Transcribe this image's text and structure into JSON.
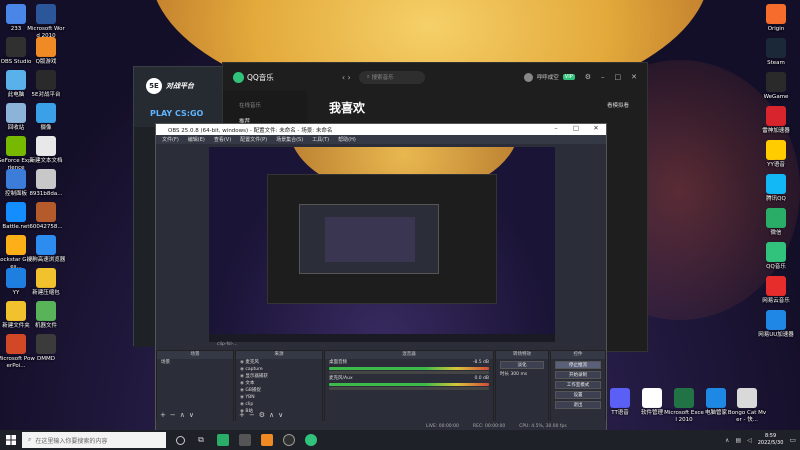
{
  "desktop_icons_left": [
    {
      "label": "233",
      "icon": "folder-icon",
      "color": "#4a86e8"
    },
    {
      "label": "Microsoft Word 2010",
      "icon": "word-icon",
      "color": "#2b579a"
    },
    {
      "label": "OBS Studio",
      "icon": "obs-icon",
      "color": "#303030"
    },
    {
      "label": "Q版游戏",
      "icon": "game-icon",
      "color": "#f08a24"
    },
    {
      "label": "此电脑",
      "icon": "computer-icon",
      "color": "#5ab0e8"
    },
    {
      "label": "5E对战平台",
      "icon": "5e-icon",
      "color": "#2a2a2a"
    },
    {
      "label": "回收站",
      "icon": "recycle-bin-icon",
      "color": "#8cb4d8"
    },
    {
      "label": "摄像",
      "icon": "camera-icon",
      "color": "#3aa0e8"
    },
    {
      "label": "GeForce Experience",
      "icon": "geforce-icon",
      "color": "#76b900"
    },
    {
      "label": "新建文本文档",
      "icon": "text-file-icon",
      "color": "#e8e8e8"
    },
    {
      "label": "控制面板",
      "icon": "control-panel-icon",
      "color": "#3b7dd8"
    },
    {
      "label": "8931b8da...",
      "icon": "image-file-icon",
      "color": "#c8c8c8"
    },
    {
      "label": "Battle.net",
      "icon": "battlenet-icon",
      "color": "#148eff"
    },
    {
      "label": "60042758...",
      "icon": "image-file-icon",
      "color": "#b55a2b"
    },
    {
      "label": "Rockstar Games...",
      "icon": "rockstar-icon",
      "color": "#fcaf17"
    },
    {
      "label": "搜狗高速浏览器",
      "icon": "sogou-browser-icon",
      "color": "#2d8cf0"
    },
    {
      "label": "YY",
      "icon": "yy-icon",
      "color": "#1e7fe0"
    },
    {
      "label": "新建压缩包",
      "icon": "zip-icon",
      "color": "#f2c12e"
    },
    {
      "label": "新建文件夹",
      "icon": "folder-icon",
      "color": "#f2c12e"
    },
    {
      "label": "机器文件",
      "icon": "file-icon",
      "color": "#59b359"
    },
    {
      "label": "Microsoft PowerPoi...",
      "icon": "powerpoint-icon",
      "color": "#d24726"
    },
    {
      "label": "DMMD",
      "icon": "dmmd-icon",
      "color": "#3b3b3b"
    }
  ],
  "desktop_icons_right": [
    {
      "label": "Origin",
      "icon": "origin-icon",
      "color": "#f56c2d"
    },
    {
      "label": "Steam",
      "icon": "steam-icon",
      "color": "#1b2838"
    },
    {
      "label": "WeGame",
      "icon": "wegame-icon",
      "color": "#2a2a2a"
    },
    {
      "label": "雷神加速器",
      "icon": "leishen-icon",
      "color": "#d8242c"
    },
    {
      "label": "YY语音",
      "icon": "yy-voice-icon",
      "color": "#ffcc00"
    },
    {
      "label": "腾讯QQ",
      "icon": "qq-icon",
      "color": "#12b7f5"
    },
    {
      "label": "微信",
      "icon": "wechat-icon",
      "color": "#2aae67"
    },
    {
      "label": "QQ音乐",
      "icon": "qq-music-icon",
      "color": "#31c27c"
    },
    {
      "label": "网易云音乐",
      "icon": "netease-music-icon",
      "color": "#e72d2c"
    },
    {
      "label": "网易UU加速器",
      "icon": "uu-accelerator-icon",
      "color": "#1f87e6"
    }
  ],
  "desktop_icons_bottom": [
    {
      "label": "Excel",
      "icon": "excel-icon",
      "color": "#217346"
    },
    {
      "label": "新建文本文档",
      "icon": "text-file-icon",
      "color": "#2b579a"
    },
    {
      "label": "",
      "icon": "shield-icon",
      "color": "#2e7dd8"
    },
    {
      "label": "Bongo Cat Mver - 快...",
      "icon": "bongo-cat-icon",
      "color": "#d9d9d9"
    },
    {
      "label": "TT语音",
      "icon": "tt-voice-icon",
      "color": "#5a5ff5"
    },
    {
      "label": "软件管理",
      "icon": "software-manager-icon",
      "color": "#fff"
    },
    {
      "label": "Microsoft Excel 2010",
      "icon": "excel-icon",
      "color": "#217346"
    },
    {
      "label": "电脑管家",
      "icon": "pc-manager-icon",
      "color": "#1e88e5"
    }
  ],
  "game_platform": {
    "title": "对战平台",
    "play_label": "PLAY CS:GO"
  },
  "qq_music": {
    "app_name": "QQ音乐",
    "search_placeholder": "搜索音乐",
    "username": "呼呼成空",
    "sidebar_section": "在线音乐",
    "sidebar_item": "推荐",
    "page_title": "我喜欢",
    "settings_label": "看模拟看"
  },
  "obs": {
    "title": "OBS 25.0.8 (64-bit, windows) - 配置文件: 未命名 - 场景: 未命名",
    "menu": [
      "文件(F)",
      "编辑(E)",
      "查看(V)",
      "配置文件(P)",
      "场景集合(S)",
      "工具(T)",
      "帮助(H)"
    ],
    "status_bar": "clip-fsl-...",
    "docks": {
      "scenes": {
        "header": "场景",
        "items": [
          "场景"
        ]
      },
      "sources": {
        "header": "来源",
        "items": [
          "麦克风",
          "capture",
          "显示器捕获",
          "文本",
          "GB捕捉",
          "YBN",
          "clip",
          "B站"
        ]
      },
      "mixer": {
        "header": "混音器",
        "tracks": [
          {
            "name": "桌面音频",
            "db": "-8.5 dB"
          },
          {
            "name": "麦克风/Aux",
            "db": "0.0 dB"
          }
        ]
      },
      "transitions": {
        "header": "转场特效",
        "type": "淡化",
        "duration_label": "时长",
        "duration": "300 ms"
      },
      "controls": {
        "header": "控件",
        "buttons": [
          "停止推流",
          "开始录制",
          "工作室模式",
          "设置",
          "退出"
        ]
      }
    },
    "bottom_status": [
      "LIVE: 00:00:00",
      "REC: 00:00:00",
      "CPU: 4.5%, 30.00 fps"
    ]
  },
  "taskbar": {
    "search_placeholder": "在这里输入你要搜索的内容",
    "time": "8:59",
    "date": "2022/5/30"
  }
}
